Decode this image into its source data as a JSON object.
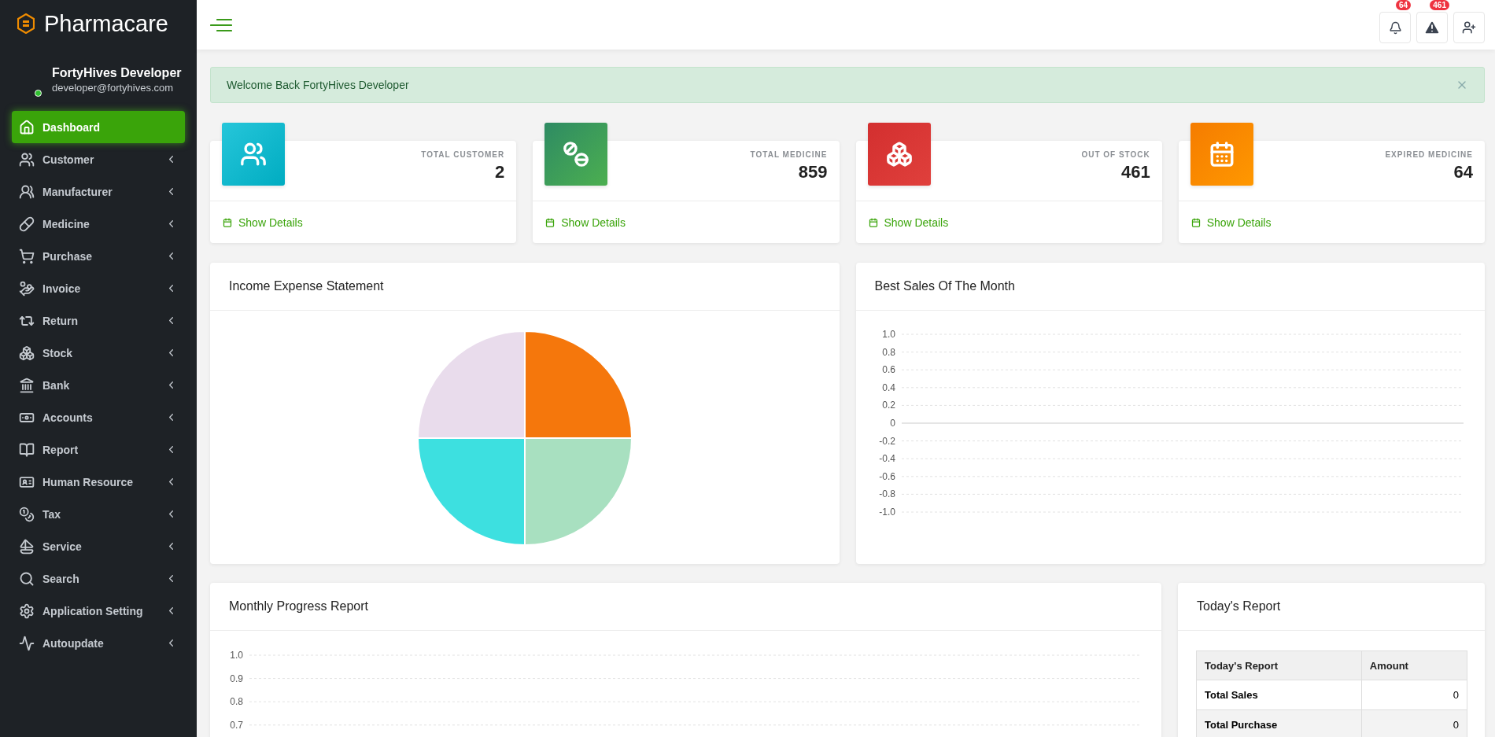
{
  "sidebar": {
    "brand": "Pharmacare",
    "user": {
      "name": "FortyHives Developer",
      "email": "developer@fortyhives.com",
      "online": true
    },
    "items": [
      {
        "label": "Dashboard",
        "selected": true,
        "has_submenu": false
      },
      {
        "label": "Customer",
        "selected": false,
        "has_submenu": true
      },
      {
        "label": "Manufacturer",
        "selected": false,
        "has_submenu": true
      },
      {
        "label": "Medicine",
        "selected": false,
        "has_submenu": true
      },
      {
        "label": "Purchase",
        "selected": false,
        "has_submenu": true
      },
      {
        "label": "Invoice",
        "selected": false,
        "has_submenu": true
      },
      {
        "label": "Return",
        "selected": false,
        "has_submenu": true
      },
      {
        "label": "Stock",
        "selected": false,
        "has_submenu": true
      },
      {
        "label": "Bank",
        "selected": false,
        "has_submenu": true
      },
      {
        "label": "Accounts",
        "selected": false,
        "has_submenu": true
      },
      {
        "label": "Report",
        "selected": false,
        "has_submenu": true
      },
      {
        "label": "Human Resource",
        "selected": false,
        "has_submenu": true
      },
      {
        "label": "Tax",
        "selected": false,
        "has_submenu": true
      },
      {
        "label": "Service",
        "selected": false,
        "has_submenu": true
      },
      {
        "label": "Search",
        "selected": false,
        "has_submenu": true
      },
      {
        "label": "Application Setting",
        "selected": false,
        "has_submenu": true
      },
      {
        "label": "Autoupdate",
        "selected": false,
        "has_submenu": true
      }
    ]
  },
  "header": {
    "notifications": {
      "badge": "64"
    },
    "alerts": {
      "badge": "461"
    }
  },
  "alert": {
    "message": "Welcome Back FortyHives Developer"
  },
  "stats": [
    {
      "label": "TOTAL CUSTOMER",
      "value": "2",
      "link": "Show Details"
    },
    {
      "label": "TOTAL MEDICINE",
      "value": "859",
      "link": "Show Details"
    },
    {
      "label": "OUT OF STOCK",
      "value": "461",
      "link": "Show Details"
    },
    {
      "label": "EXPIRED MEDICINE",
      "value": "64",
      "link": "Show Details"
    }
  ],
  "income_expense": {
    "title": "Income Expense Statement"
  },
  "best_sales": {
    "title": "Best Sales Of The Month",
    "axis_labels": [
      "1.0",
      "0.8",
      "0.6",
      "0.4",
      "0.2",
      "0",
      "-0.2",
      "-0.4",
      "-0.6",
      "-0.8",
      "-1.0"
    ]
  },
  "monthly_progress": {
    "title": "Monthly Progress Report",
    "axis_labels": [
      "1.0",
      "0.9",
      "0.8",
      "0.7"
    ]
  },
  "todays_report": {
    "title": "Today's Report",
    "columns": [
      "Today's Report",
      "Amount"
    ],
    "rows": [
      [
        "Total Sales",
        "0"
      ],
      [
        "Total Purchase",
        "0"
      ]
    ]
  }
}
